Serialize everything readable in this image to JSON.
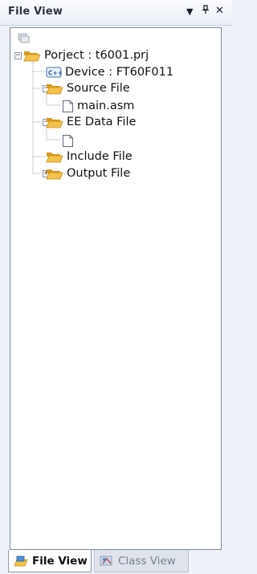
{
  "panel": {
    "title": "File View",
    "controls": {
      "menu": "▼",
      "pin": "ꟸ",
      "close": "✕"
    }
  },
  "tree": {
    "project": {
      "label": "Porject : t6001.prj",
      "expanded": true
    },
    "device": {
      "label": "Device : FT60F011",
      "icon": "device-icon"
    },
    "source_file": {
      "label": "Source File",
      "expanded": true
    },
    "main_asm": {
      "label": "main.asm"
    },
    "ee_data_file": {
      "label": "EE Data File",
      "expanded": true
    },
    "ee_child": {
      "label": ""
    },
    "include_file": {
      "label": "Include File"
    },
    "output_file": {
      "label": "Output File",
      "expanded": false
    }
  },
  "tabs": [
    {
      "label": "File View",
      "active": true
    },
    {
      "label": "Class View",
      "active": false
    }
  ],
  "colors": {
    "folder": "#f3c24a",
    "folder_dark": "#d99a1e",
    "panel_bg": "#ffffff",
    "chrome_bg": "#eef2f8"
  }
}
